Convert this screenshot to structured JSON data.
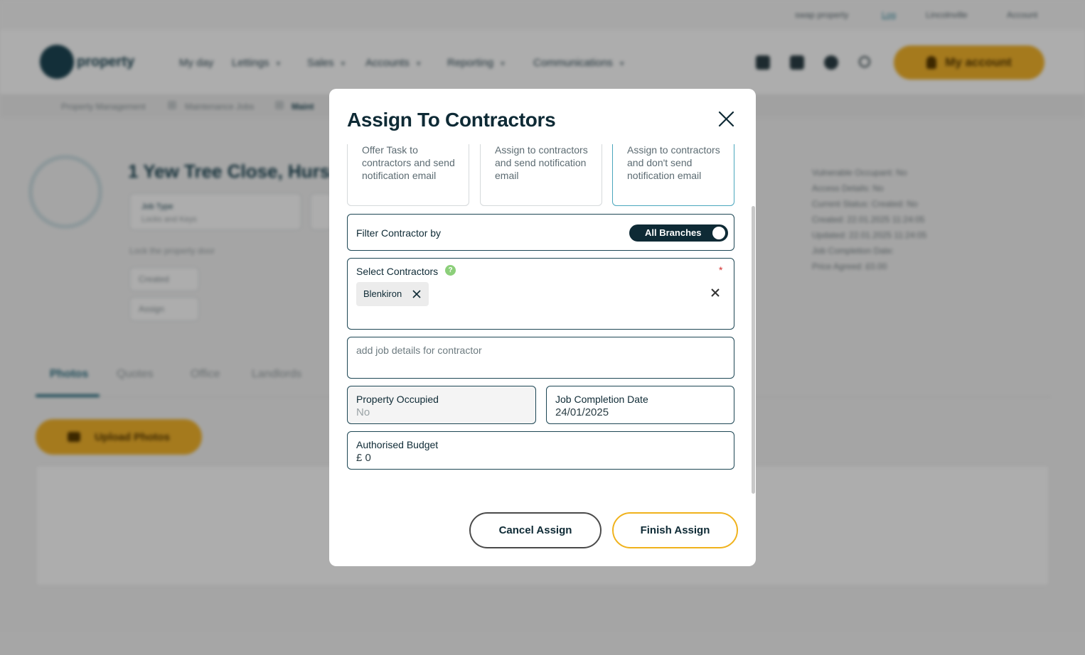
{
  "background": {
    "top_links": [
      "swap property",
      "Log",
      "Lincolnville",
      "Account"
    ],
    "brand": "property",
    "nav": [
      "My day",
      "Lettings",
      "Sales",
      "Accounts",
      "Reporting",
      "Communications"
    ],
    "account_button": "My account",
    "breadcrumbs": [
      "Property Management",
      "Maintenance Jobs",
      "Maint"
    ],
    "property_title": "1 Yew Tree Close, Hurs",
    "job_type_label": "Job Type",
    "job_type_value": "Locks and Keys",
    "description": "Lock the property door",
    "status_value": "Created",
    "assign_chip": "Assign",
    "info_lines": [
      "Vulnerable Occupant: No",
      "Access Details: No",
      "Current Status: Created: No",
      "Created: 22.01.2025 11:24:05",
      "Updated: 22.01.2025 11:24:05",
      "Job Completion Date:",
      "Price Agreed: £0.00"
    ],
    "tabs": [
      "Photos",
      "Quotes",
      "Office",
      "Landlords"
    ],
    "upload_button": "Upload Photos"
  },
  "modal": {
    "title": "Assign To Contractors",
    "options": [
      {
        "description": "Offer Task to contractors and send notification email",
        "selected": false
      },
      {
        "description": "Assign to contractors and send notification email",
        "selected": false
      },
      {
        "description": "Assign to contractors and don't send notification email",
        "selected": true
      }
    ],
    "filter": {
      "label": "Filter Contractor by",
      "toggle_label": "All Branches",
      "toggle_on": true
    },
    "select_contractors": {
      "label": "Select Contractors",
      "required_mark": "*",
      "help_glyph": "?",
      "selected": [
        "Blenkiron"
      ]
    },
    "job_details_placeholder": "add job details for contractor",
    "property_occupied": {
      "label": "Property Occupied",
      "value": "No"
    },
    "job_completion_date": {
      "label": "Job Completion Date",
      "value": "24/01/2025"
    },
    "authorised_budget": {
      "label": "Authorised Budget",
      "value": "£ 0"
    },
    "cancel_label": "Cancel Assign",
    "finish_label": "Finish Assign"
  },
  "colors": {
    "primary_dark": "#0e2a35",
    "accent_yellow": "#f0b21c",
    "selected_border": "#4aa6bd",
    "required_red": "#d32f2f",
    "help_green": "#8ccf7a"
  },
  "icons": {
    "close": "close-icon",
    "chip_remove": "remove-chip-icon",
    "clear_all": "clear-all-icon",
    "help": "help-icon"
  }
}
